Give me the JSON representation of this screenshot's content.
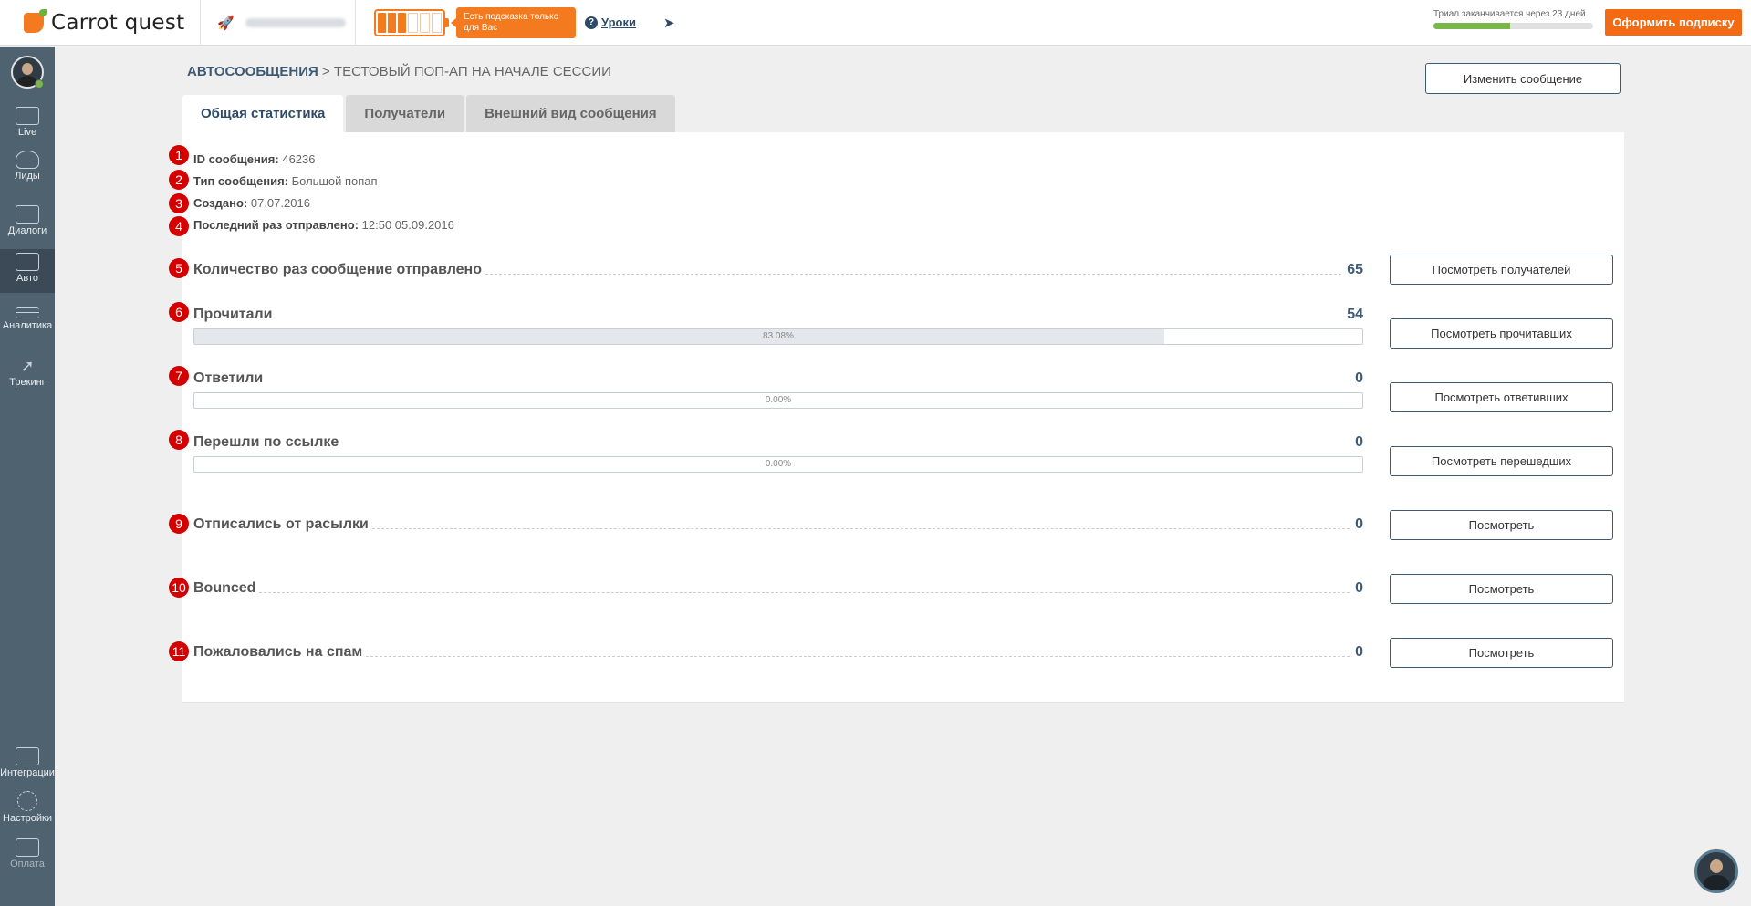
{
  "app": {
    "logo_text": "Carrot quest"
  },
  "topbar": {
    "hint_text": "Есть подсказка только для Вас",
    "help_label": "Уроки",
    "trial_text": "Триал заканчивается через 23 дней",
    "trial_progress": 0.48,
    "subscribe_label": "Оформить подписку",
    "battery_cells_filled": 3,
    "battery_cells_total": 6
  },
  "sidebar": {
    "items": [
      {
        "label": "Live",
        "icon": "pulse-icon"
      },
      {
        "label": "Лиды",
        "icon": "users-icon"
      },
      {
        "label": "Диалоги",
        "icon": "chat-icon"
      },
      {
        "label": "Авто",
        "icon": "auto-message-icon",
        "active": true
      },
      {
        "label": "Аналитика",
        "icon": "analytics-icon"
      },
      {
        "label": "Трекинг",
        "icon": "cursor-icon"
      },
      {
        "label": "Интеграции",
        "icon": "puzzle-icon"
      },
      {
        "label": "Настройки",
        "icon": "gear-icon"
      },
      {
        "label": "Оплата",
        "icon": "card-icon"
      }
    ]
  },
  "breadcrumb": {
    "parent": "АВТОСООБЩЕНИЯ",
    "separator": " > ",
    "current": "ТЕСТОВЫЙ ПОП-АП НА НАЧАЛЕ СЕССИИ"
  },
  "edit_button": "Изменить сообщение",
  "tabs": [
    {
      "label": "Общая статистика",
      "active": true
    },
    {
      "label": "Получатели"
    },
    {
      "label": "Внешний вид сообщения"
    }
  ],
  "info": [
    {
      "badge": "1",
      "label": "ID сообщения:",
      "value": "46236"
    },
    {
      "badge": "2",
      "label": "Тип сообщения:",
      "value": "Большой попап"
    },
    {
      "badge": "3",
      "label": "Создано:",
      "value": "07.07.2016"
    },
    {
      "badge": "4",
      "label": "Последний раз отправлено:",
      "value": "12:50 05.09.2016"
    }
  ],
  "stats": [
    {
      "badge": "5",
      "label": "Количество раз сообщение отправлено",
      "value": "65",
      "button": "Посмотреть получателей"
    },
    {
      "badge": "6",
      "label": "Прочитали",
      "value": "54",
      "percent_text": "83.08%",
      "percent": 83.08,
      "button": "Посмотреть прочитавших"
    },
    {
      "badge": "7",
      "label": "Ответили",
      "value": "0",
      "percent_text": "0.00%",
      "percent": 0,
      "button": "Посмотреть ответивших"
    },
    {
      "badge": "8",
      "label": "Перешли по ссылке",
      "value": "0",
      "percent_text": "0.00%",
      "percent": 0,
      "button": "Посмотреть перешедших"
    },
    {
      "badge": "9",
      "label": "Отписались от расылки",
      "value": "0",
      "button": "Посмотреть"
    },
    {
      "badge": "10",
      "label": "Bounced",
      "value": "0",
      "button": "Посмотреть"
    },
    {
      "badge": "11",
      "label": "Пожаловались на спам",
      "value": "0",
      "button": "Посмотреть"
    }
  ],
  "colors": {
    "accent": "#f46a12",
    "primary": "#3d5a75",
    "badge": "#d40000",
    "sidebar": "#4f6270"
  }
}
